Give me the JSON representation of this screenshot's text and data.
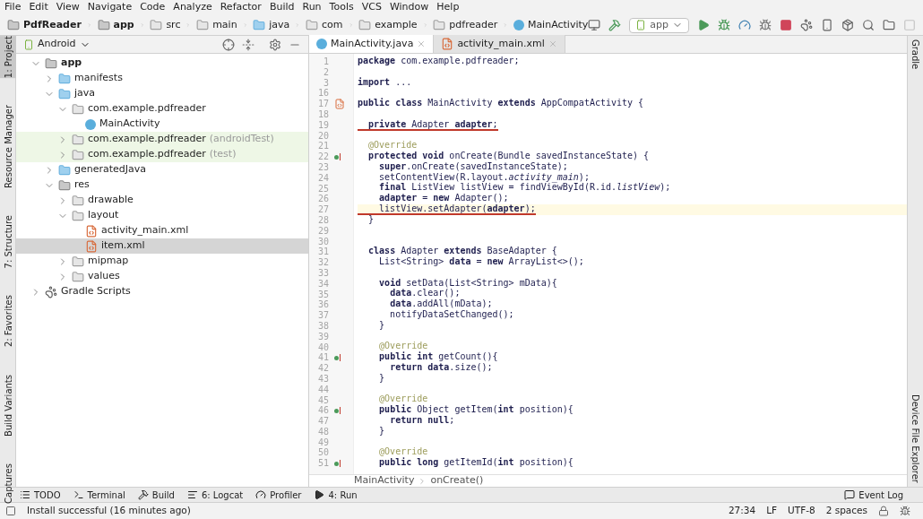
{
  "menu": [
    "File",
    "Edit",
    "View",
    "Navigate",
    "Code",
    "Analyze",
    "Refactor",
    "Build",
    "Run",
    "Tools",
    "VCS",
    "Window",
    "Help"
  ],
  "breadcrumb": [
    {
      "label": "PdfReader",
      "kind": "project"
    },
    {
      "label": "app",
      "kind": "module"
    },
    {
      "label": "src",
      "kind": "folder"
    },
    {
      "label": "main",
      "kind": "folder"
    },
    {
      "label": "java",
      "kind": "source"
    },
    {
      "label": "com",
      "kind": "package"
    },
    {
      "label": "example",
      "kind": "package"
    },
    {
      "label": "pdfreader",
      "kind": "package"
    },
    {
      "label": "MainActivity",
      "kind": "class"
    }
  ],
  "run_config": "app",
  "left_tool_tabs": [
    {
      "label": "1: Project",
      "selected": true
    },
    {
      "label": "Resource Manager",
      "selected": false
    },
    {
      "label": "7: Structure",
      "selected": false
    },
    {
      "label": "2: Favorites",
      "selected": false
    },
    {
      "label": "Build Variants",
      "selected": false
    },
    {
      "label": "Captures",
      "selected": false
    }
  ],
  "right_tool_tabs": [
    "Gradle",
    "Device File Explorer"
  ],
  "project_view": "Android",
  "tree": [
    {
      "label": "app",
      "kind": "module",
      "expanded": true,
      "selected": false,
      "highlighted": false,
      "children": [
        {
          "label": "manifests",
          "kind": "source",
          "expanded": false,
          "selected": false,
          "highlighted": false
        },
        {
          "label": "java",
          "kind": "source",
          "expanded": true,
          "selected": false,
          "highlighted": false,
          "children": [
            {
              "label": "com.example.pdfreader",
              "kind": "package",
              "expanded": true,
              "selected": false,
              "highlighted": false,
              "children": [
                {
                  "label": "MainActivity",
                  "kind": "class",
                  "selected": false,
                  "highlighted": false
                }
              ]
            },
            {
              "label": "com.example.pdfreader",
              "suffix": "(androidTest)",
              "kind": "package",
              "expanded": false,
              "selected": false,
              "highlighted": true
            },
            {
              "label": "com.example.pdfreader",
              "suffix": "(test)",
              "kind": "package",
              "expanded": false,
              "selected": false,
              "highlighted": true
            }
          ]
        },
        {
          "label": "generatedJava",
          "kind": "source",
          "expanded": false,
          "selected": false,
          "highlighted": false
        },
        {
          "label": "res",
          "kind": "res",
          "expanded": true,
          "selected": false,
          "highlighted": false,
          "children": [
            {
              "label": "drawable",
              "kind": "package",
              "expanded": false,
              "selected": false,
              "highlighted": false
            },
            {
              "label": "layout",
              "kind": "package",
              "expanded": true,
              "selected": false,
              "highlighted": false,
              "children": [
                {
                  "label": "activity_main.xml",
                  "kind": "xml",
                  "selected": false,
                  "highlighted": false
                },
                {
                  "label": "item.xml",
                  "kind": "xml",
                  "selected": true,
                  "highlighted": false
                }
              ]
            },
            {
              "label": "mipmap",
              "kind": "package",
              "expanded": false,
              "selected": false,
              "highlighted": false
            },
            {
              "label": "values",
              "kind": "package",
              "expanded": false,
              "selected": false,
              "highlighted": false
            }
          ]
        }
      ]
    },
    {
      "label": "Gradle Scripts",
      "kind": "gradle",
      "expanded": false,
      "selected": false,
      "highlighted": false
    }
  ],
  "editor_tabs": [
    {
      "label": "MainActivity.java",
      "kind": "class",
      "selected": true
    },
    {
      "label": "activity_main.xml",
      "kind": "xml",
      "selected": false
    }
  ],
  "code_lines": [
    {
      "n": "1",
      "text": "**package** com.example.pdfreader;",
      "kind": "code",
      "underlined": false,
      "current": false
    },
    {
      "n": "2"
    },
    {
      "n": "3",
      "text": "**import** ...",
      "kind": "code",
      "underlined": false,
      "current": false
    },
    {
      "n": "16"
    },
    {
      "n": "17",
      "text": "**public class** MainActivity **extends** AppCompatActivity {",
      "kind": "code",
      "underlined": false,
      "current": false,
      "gutter_icon": {
        "kind": "xml"
      }
    },
    {
      "n": "18"
    },
    {
      "n": "19",
      "text": "  **private** Adapter **adapter**;",
      "kind": "code",
      "underlined": true,
      "current": false
    },
    {
      "n": "20"
    },
    {
      "n": "21",
      "text": "  @Override",
      "kind": "annotation",
      "underlined": false,
      "current": false
    },
    {
      "n": "22",
      "text": "  **protected void** onCreate(Bundle savedInstanceState) {",
      "kind": "code",
      "underlined": false,
      "current": false,
      "gutter_icon": {
        "kind": "override"
      }
    },
    {
      "n": "23",
      "text": "    **super**.onCreate(savedInstanceState);",
      "kind": "code",
      "underlined": false,
      "current": false
    },
    {
      "n": "24",
      "text": "    setContentView(R.layout.*activity_main*);",
      "kind": "code",
      "underlined": false,
      "current": false
    },
    {
      "n": "25",
      "text": "    **final** ListView listView = findViewById(R.id.*listView*);",
      "kind": "code",
      "underlined": false,
      "current": false
    },
    {
      "n": "26",
      "text": "    **adapter** = **new** Adapter();",
      "kind": "code",
      "underlined": false,
      "current": false
    },
    {
      "n": "27",
      "text": "    listView.setAdapter(**adapter**);",
      "kind": "code",
      "underlined": true,
      "current": true
    },
    {
      "n": "28",
      "text": "  }",
      "kind": "code",
      "underlined": false,
      "current": false
    },
    {
      "n": "29"
    },
    {
      "n": "30"
    },
    {
      "n": "31",
      "text": "  **class** Adapter **extends** BaseAdapter {",
      "kind": "code",
      "underlined": false,
      "current": false
    },
    {
      "n": "32",
      "text": "    List<String> **data** = **new** ArrayList<>();",
      "kind": "code",
      "underlined": false,
      "current": false
    },
    {
      "n": "33"
    },
    {
      "n": "34",
      "text": "    **void** setData(List<String> mData){",
      "kind": "code",
      "underlined": false,
      "current": false
    },
    {
      "n": "35",
      "text": "      **data**.clear();",
      "kind": "code",
      "underlined": false,
      "current": false
    },
    {
      "n": "36",
      "text": "      **data**.addAll(mData);",
      "kind": "code",
      "underlined": false,
      "current": false
    },
    {
      "n": "37",
      "text": "      notifyDataSetChanged();",
      "kind": "code",
      "underlined": false,
      "current": false
    },
    {
      "n": "38",
      "text": "    }",
      "kind": "code",
      "underlined": false,
      "current": false
    },
    {
      "n": "39"
    },
    {
      "n": "40",
      "text": "    @Override",
      "kind": "annotation",
      "underlined": false,
      "current": false
    },
    {
      "n": "41",
      "text": "    **public int** getCount(){",
      "kind": "code",
      "underlined": false,
      "current": false,
      "gutter_icon": {
        "kind": "override"
      }
    },
    {
      "n": "42",
      "text": "      **return data**.size();",
      "kind": "code",
      "underlined": false,
      "current": false
    },
    {
      "n": "43",
      "text": "    }",
      "kind": "code",
      "underlined": false,
      "current": false
    },
    {
      "n": "44"
    },
    {
      "n": "45",
      "text": "    @Override",
      "kind": "annotation",
      "underlined": false,
      "current": false
    },
    {
      "n": "46",
      "text": "    **public** Object getItem(**int** position){",
      "kind": "code",
      "underlined": false,
      "current": false,
      "gutter_icon": {
        "kind": "override"
      }
    },
    {
      "n": "47",
      "text": "      **return null**;",
      "kind": "code",
      "underlined": false,
      "current": false
    },
    {
      "n": "48",
      "text": "    }",
      "kind": "code",
      "underlined": false,
      "current": false
    },
    {
      "n": "49"
    },
    {
      "n": "50",
      "text": "    @Override",
      "kind": "annotation",
      "underlined": false,
      "current": false
    },
    {
      "n": "51",
      "text": "    **public long** getItemId(**int** position){",
      "kind": "code",
      "underlined": false,
      "current": false,
      "gutter_icon": {
        "kind": "override"
      }
    }
  ],
  "code_breadcrumb": [
    "MainActivity",
    "onCreate()"
  ],
  "bottom_tool_tabs": [
    {
      "label": "TODO",
      "kind": "list"
    },
    {
      "label": "Terminal",
      "kind": "terminal"
    },
    {
      "label": "Build",
      "kind": "hammer"
    },
    {
      "label": "6: Logcat",
      "kind": "lines"
    },
    {
      "label": "Profiler",
      "kind": "gauge"
    },
    {
      "label": "4: Run",
      "kind": "play"
    }
  ],
  "event_log": "Event Log",
  "status": {
    "message": "Install successful (16 minutes ago)",
    "position": "27:34",
    "line_separator": "LF",
    "encoding": "UTF-8",
    "indent": "2 spaces"
  }
}
